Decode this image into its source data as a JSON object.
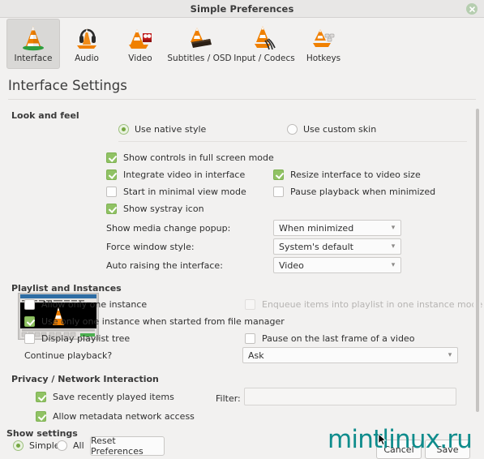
{
  "window": {
    "title": "Simple Preferences",
    "close_icon": "close-icon"
  },
  "tabs": [
    {
      "label": "Interface",
      "icon": "vlc-cone-icon",
      "selected": true
    },
    {
      "label": "Audio",
      "icon": "vlc-headphones-icon",
      "selected": false
    },
    {
      "label": "Video",
      "icon": "vlc-video-icon",
      "selected": false
    },
    {
      "label": "Subtitles / OSD",
      "icon": "vlc-subtitles-icon",
      "selected": false
    },
    {
      "label": "Input / Codecs",
      "icon": "vlc-input-codecs-icon",
      "selected": false
    },
    {
      "label": "Hotkeys",
      "icon": "vlc-hotkeys-icon",
      "selected": false
    }
  ],
  "page": {
    "title": "Interface Settings"
  },
  "look_and_feel": {
    "heading": "Look and feel",
    "native_style": {
      "label": "Use native style",
      "checked": true
    },
    "custom_skin": {
      "label": "Use custom skin",
      "checked": false
    },
    "show_controls_fullscreen": {
      "label": "Show controls in full screen mode",
      "checked": true
    },
    "integrate_video": {
      "label": "Integrate video in interface",
      "checked": true
    },
    "resize_interface": {
      "label": "Resize interface to video size",
      "checked": true
    },
    "minimal_view": {
      "label": "Start in minimal view mode",
      "checked": false
    },
    "pause_minimized": {
      "label": "Pause playback when minimized",
      "checked": false
    },
    "systray": {
      "label": "Show systray icon",
      "checked": true
    },
    "media_change_popup": {
      "label": "Show media change popup:",
      "value": "When minimized"
    },
    "force_window_style": {
      "label": "Force window style:",
      "value": "System's default"
    },
    "auto_raise": {
      "label": "Auto raising the interface:",
      "value": "Video"
    }
  },
  "playlist_instances": {
    "heading": "Playlist and Instances",
    "one_instance": {
      "label": "Allow only one instance",
      "checked": false
    },
    "enqueue_items": {
      "label": "Enqueue items into playlist in one instance mode",
      "checked": false,
      "disabled": true
    },
    "one_instance_file_manager": {
      "label": "Use only one instance when started from file manager",
      "checked": true
    },
    "playlist_tree": {
      "label": "Display playlist tree",
      "checked": false
    },
    "pause_last_frame": {
      "label": "Pause on the last frame of a video",
      "checked": false
    },
    "continue_playback": {
      "label": "Continue playback?",
      "value": "Ask"
    }
  },
  "privacy": {
    "heading": "Privacy / Network Interaction",
    "save_recent": {
      "label": "Save recently played items",
      "checked": true
    },
    "metadata_access": {
      "label": "Allow metadata network access",
      "checked": true
    },
    "filter": {
      "label": "Filter:",
      "value": "",
      "placeholder": ""
    }
  },
  "footer": {
    "show_settings_label": "Show settings",
    "simple": {
      "label": "Simple",
      "checked": true
    },
    "all": {
      "label": "All",
      "checked": false
    },
    "reset_button": "Reset Preferences",
    "cancel_button": "Cancel",
    "save_button": "Save"
  },
  "watermark": {
    "text": "mintlinux.ru",
    "color": "#0f8c8c"
  },
  "colors": {
    "window_bg": "#f2f1f0",
    "titlebar_bg": "#e8e7e6",
    "check_green": "#90c264",
    "radio_green": "#76a843",
    "tab_selected": "#d9d8d6"
  }
}
